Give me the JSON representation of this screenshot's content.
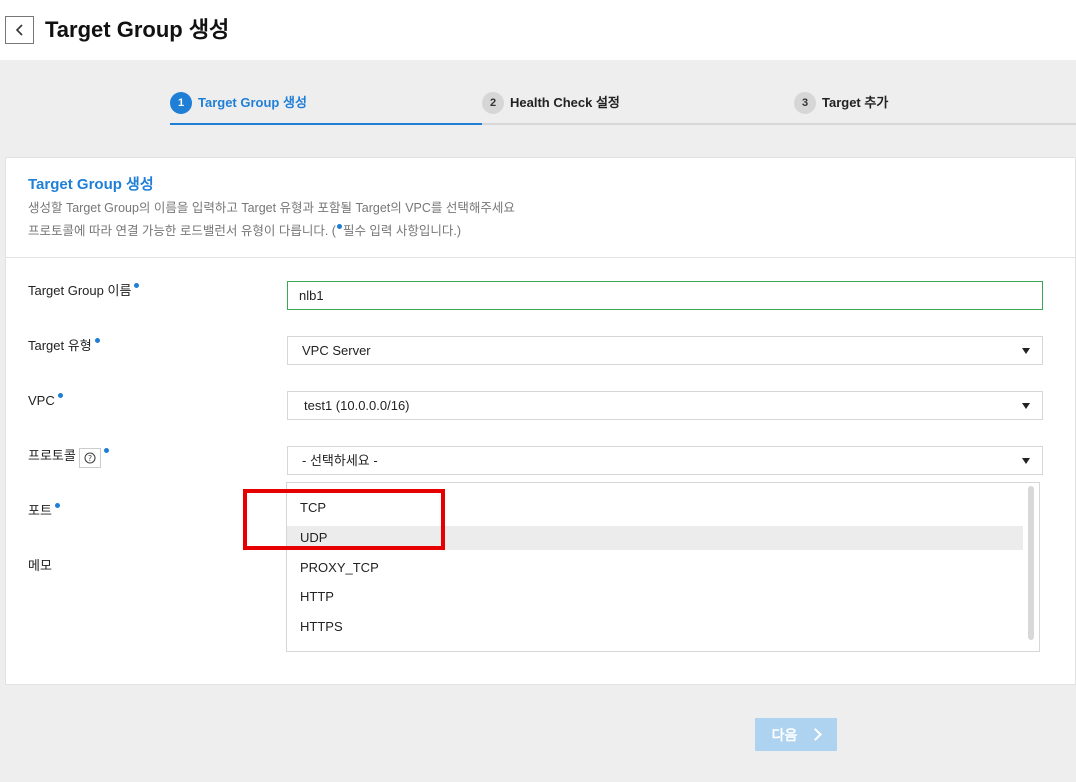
{
  "header": {
    "title": "Target Group 생성"
  },
  "steps": [
    {
      "num": "1",
      "label": "Target Group 생성",
      "active": true
    },
    {
      "num": "2",
      "label": "Health Check 설정",
      "active": false
    },
    {
      "num": "3",
      "label": "Target 추가",
      "active": false
    }
  ],
  "card": {
    "title": "Target Group 생성",
    "desc_line1": "생성할 Target Group의 이름을 입력하고 Target 유형과 포함될 Target의 VPC를 선택해주세요",
    "desc_line2_pre": "프로토콜에 따라 연결 가능한 로드밸런서 유형이 다릅니다. (",
    "desc_line2_post": "필수 입력 사항입니다.)"
  },
  "form": {
    "name_label": "Target Group 이름",
    "name_value": "nlb1",
    "type_label": "Target 유형",
    "type_value": "VPC Server",
    "vpc_label": "VPC",
    "vpc_value": "test1 (10.0.0.0/16)",
    "protocol_label": "프로토콜",
    "protocol_value": "- 선택하세요 -",
    "port_label": "포트",
    "memo_label": "메모"
  },
  "protocol_options": [
    "TCP",
    "UDP",
    "PROXY_TCP",
    "HTTP",
    "HTTPS"
  ],
  "hovered_option": "UDP",
  "footer": {
    "next_label": "다음"
  },
  "colors": {
    "accent": "#1f7fd6",
    "annotation": "#e60000",
    "next_disabled": "#aed3f1",
    "valid_border": "#3aa757"
  }
}
